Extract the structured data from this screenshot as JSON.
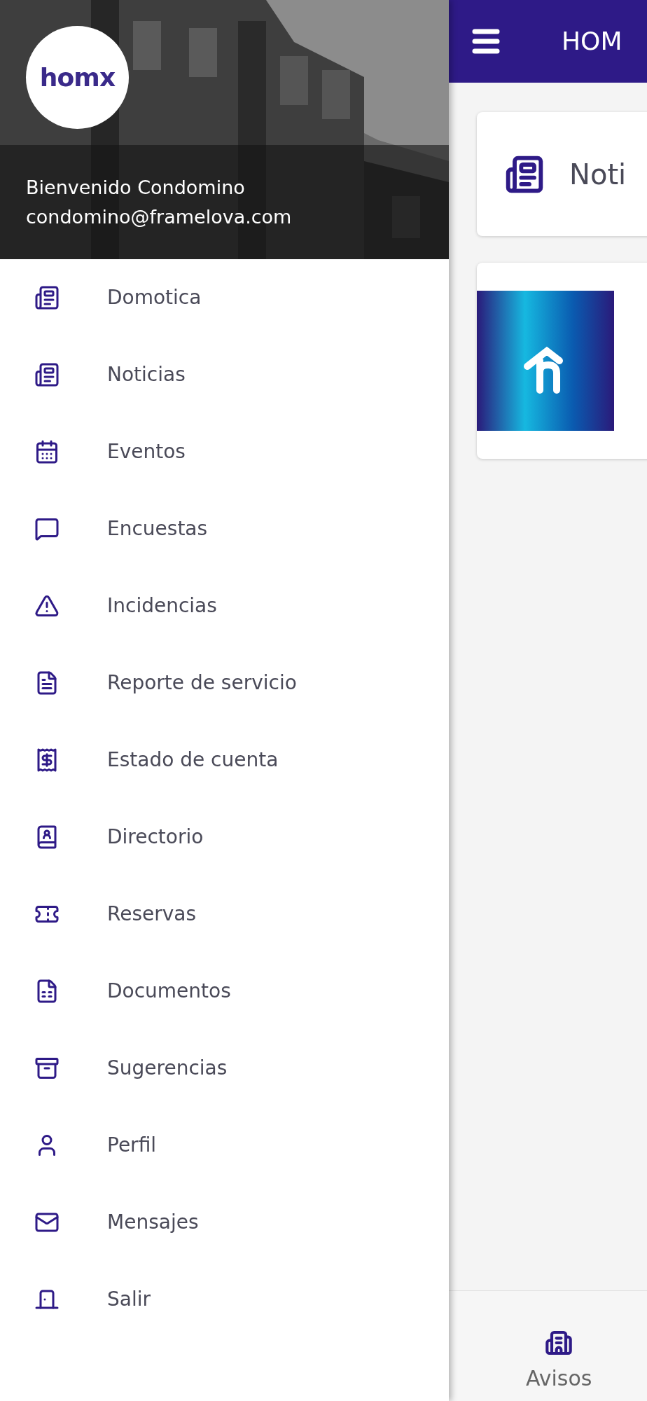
{
  "drawer": {
    "logo": "homx",
    "welcome": "Bienvenido Condomino",
    "email": "condomino@framelova.com",
    "items": [
      {
        "label": "Domotica"
      },
      {
        "label": "Noticias"
      },
      {
        "label": "Eventos"
      },
      {
        "label": "Encuestas"
      },
      {
        "label": "Incidencias"
      },
      {
        "label": "Reporte de servicio"
      },
      {
        "label": "Estado de cuenta"
      },
      {
        "label": "Directorio"
      },
      {
        "label": "Reservas"
      },
      {
        "label": "Documentos"
      },
      {
        "label": "Sugerencias"
      },
      {
        "label": "Perfil"
      },
      {
        "label": "Mensajes"
      },
      {
        "label": "Salir"
      }
    ]
  },
  "app_bar": {
    "title": "HOM"
  },
  "section_card": {
    "title": "Noti"
  },
  "bottom_nav": {
    "items": [
      {
        "label": "Avisos"
      }
    ]
  }
}
